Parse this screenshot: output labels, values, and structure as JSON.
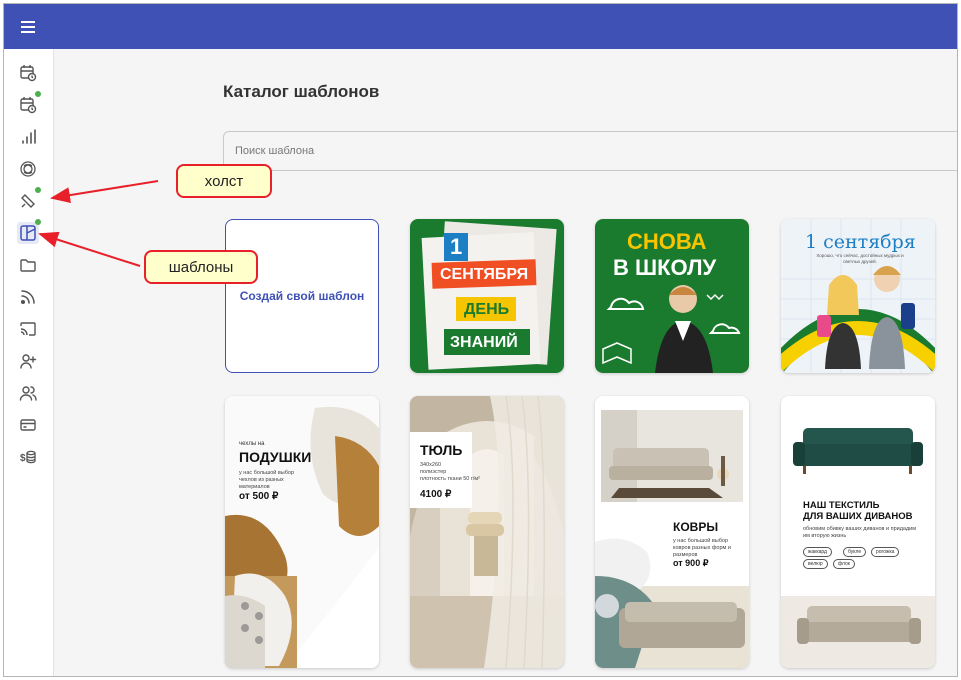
{
  "header": {
    "menu_icon": "hamburger-icon",
    "color": "#3f51b5"
  },
  "sidebar": {
    "items": [
      {
        "icon": "calendar-clock-icon",
        "dot": false
      },
      {
        "icon": "calendar-clock-dot-icon",
        "dot": true
      },
      {
        "icon": "bar-chart-icon",
        "dot": false
      },
      {
        "icon": "ai-knot-icon",
        "dot": false
      },
      {
        "icon": "canvas-brush-icon",
        "dot": true
      },
      {
        "icon": "template-layout-icon",
        "dot": true,
        "active": true
      },
      {
        "icon": "folder-icon",
        "dot": false
      },
      {
        "icon": "rss-icon",
        "dot": false
      },
      {
        "icon": "cast-icon",
        "dot": false
      },
      {
        "icon": "add-user-icon",
        "dot": false
      },
      {
        "icon": "users-icon",
        "dot": false
      },
      {
        "icon": "credit-card-icon",
        "dot": false
      },
      {
        "icon": "dollar-coins-icon",
        "dot": false
      }
    ]
  },
  "main": {
    "title": "Каталог шаблонов",
    "search_placeholder": "Поиск шаблона",
    "create_label": "Создай свой шаблон"
  },
  "templates": {
    "t1": {
      "num": "1",
      "l1": "СЕНТЯБРЯ",
      "l2": "ДЕНЬ",
      "l3": "ЗНАНИЙ"
    },
    "t2": {
      "l1": "СНОВА",
      "l2": "В ШКОЛУ"
    },
    "t3": {
      "l1": "1 сентября",
      "sub": "Хорошо, что сейчас, достойных мудрых и светлых друзей."
    },
    "t4": {
      "pre": "чехлы на",
      "title": "ПОДУШКИ",
      "desc": "у нас большой выбор чехлов из разных материалов",
      "price": "от 500 ₽"
    },
    "t5": {
      "title": "ТЮЛЬ",
      "desc1": "340х260",
      "desc2": "полиэстер",
      "desc3": "плотность ткани 50 г/м²",
      "price": "4100 ₽"
    },
    "t6": {
      "title": "КОВРЫ",
      "desc": "у нас большой выбор ковров разных форм и размеров",
      "price": "от 900 ₽"
    },
    "t7": {
      "title1": "НАШ ТЕКСТИЛЬ",
      "title2": "ДЛЯ ВАШИХ ДИВАНОВ",
      "desc": "обновим обивку ваших диванов и придадим им вторую жизнь",
      "tags": [
        "жаккард",
        "букле",
        "рогожка",
        "велюр",
        "флок"
      ]
    }
  },
  "callouts": {
    "canvas": "холст",
    "templates": "шаблоны"
  },
  "colors": {
    "accent": "#3f51b5",
    "green_dot": "#4caf50",
    "callout_bg": "#ffffcc",
    "callout_border": "#e8202a",
    "school_green": "#1a7a2e"
  }
}
